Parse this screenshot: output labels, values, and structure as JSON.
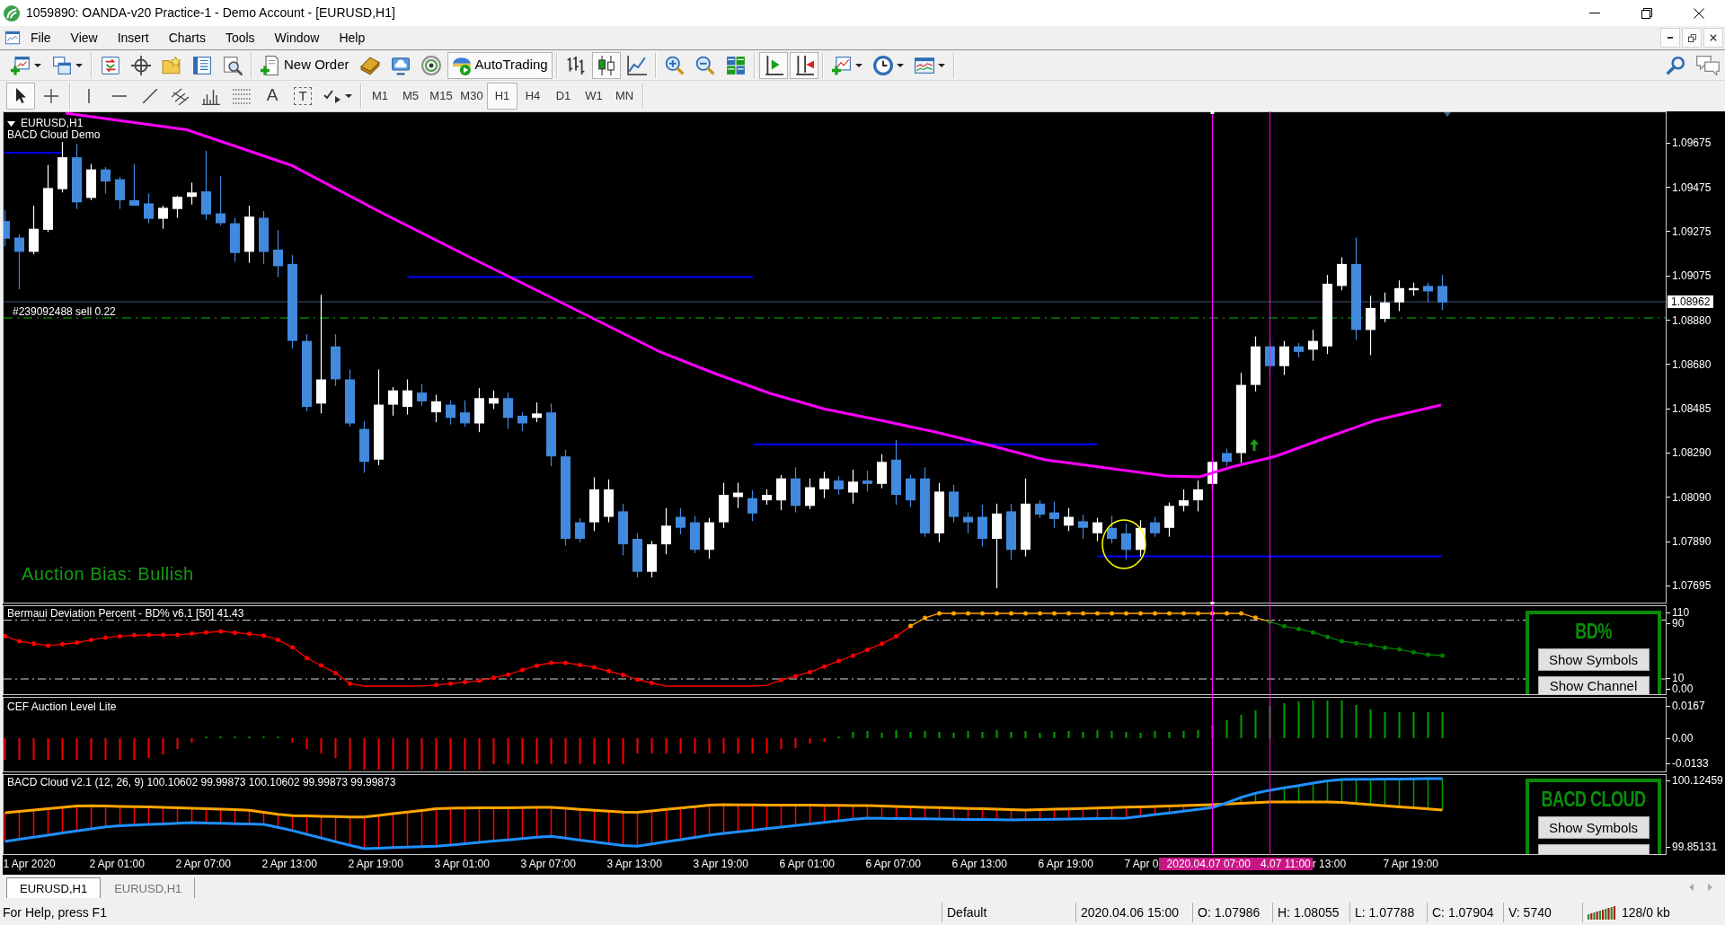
{
  "window": {
    "title": "1059890: OANDA-v20 Practice-1 - Demo Account - [EURUSD,H1]"
  },
  "menu": [
    "File",
    "View",
    "Insert",
    "Charts",
    "Tools",
    "Window",
    "Help"
  ],
  "toolbar": {
    "new_order": "New Order",
    "autotrading": {
      "label": "AutoTrading",
      "on": true
    },
    "chart_types": [
      {
        "kind": "bars",
        "selected": false
      },
      {
        "kind": "candles",
        "selected": true
      },
      {
        "kind": "line",
        "selected": false
      }
    ],
    "autoscroll": {
      "on": true
    },
    "chart_shift": {
      "on": true
    }
  },
  "drawing_tools": [
    {
      "kind": "cursor",
      "selected": true
    },
    {
      "kind": "crosshair",
      "selected": false
    },
    {
      "kind": "vertical_line",
      "selected": false
    },
    {
      "kind": "horizontal_line",
      "selected": false
    },
    {
      "kind": "trendline",
      "selected": false
    },
    {
      "kind": "channel",
      "selected": false
    },
    {
      "kind": "cycles",
      "selected": false
    },
    {
      "kind": "fibonacci",
      "selected": false
    },
    {
      "kind": "text",
      "label": "A",
      "selected": false
    },
    {
      "kind": "text_label",
      "label": "T",
      "selected": false
    },
    {
      "kind": "arrows",
      "selected": false
    }
  ],
  "timeframes": [
    {
      "label": "M1",
      "selected": false
    },
    {
      "label": "M5",
      "selected": false
    },
    {
      "label": "M15",
      "selected": false
    },
    {
      "label": "M30",
      "selected": false
    },
    {
      "label": "H1",
      "selected": true
    },
    {
      "label": "H4",
      "selected": false
    },
    {
      "label": "D1",
      "selected": false
    },
    {
      "label": "W1",
      "selected": false
    },
    {
      "label": "MN",
      "selected": false
    }
  ],
  "chart": {
    "symbol": "EURUSD,H1",
    "indicator": "BACD Cloud Demo",
    "order_label": "#239092488 sell 0.22",
    "bias": "Auction Bias: Bullish",
    "price_axis": [
      "1.09675",
      "1.09475",
      "1.09275",
      "1.09075",
      "1.08880",
      "1.08680",
      "1.08485",
      "1.08290",
      "1.08090",
      "1.07890",
      "1.07695"
    ],
    "current_price": "1.08962"
  },
  "indicator_panels": [
    {
      "kind": "bd",
      "title": "Bermaui Deviation Percent - BD% v6.1 [50] 41.43",
      "axis": [
        "110",
        "90",
        "10",
        "0.00"
      ],
      "widget": {
        "title": "BD%",
        "buttons": [
          {
            "kind": "button",
            "label": "Show Symbols"
          },
          {
            "kind": "button",
            "label": "Show Channel"
          }
        ]
      }
    },
    {
      "kind": "cef",
      "title": "CEF Auction Level Lite",
      "axis": [
        "0.0167",
        "0.00",
        "-0.0133"
      ]
    },
    {
      "kind": "bacd",
      "title": "BACD Cloud v2.1 (12, 26, 9) 100.10602 99.99873 100.10602 99.99873 99.99873",
      "axis": [
        "100.12459",
        "99.85131"
      ],
      "widget": {
        "title": "BACD CLOUD",
        "buttons": [
          {
            "kind": "button",
            "label": "Show Symbols"
          },
          {
            "kind": "stub"
          }
        ]
      }
    }
  ],
  "time_axis": [
    {
      "kind": "tick",
      "label": "1 Apr 2020"
    },
    {
      "kind": "tick",
      "label": "2 Apr 01:00"
    },
    {
      "kind": "tick",
      "label": "2 Apr 07:00"
    },
    {
      "kind": "tick",
      "label": "2 Apr 13:00"
    },
    {
      "kind": "tick",
      "label": "2 Apr 19:00"
    },
    {
      "kind": "tick",
      "label": "3 Apr 01:00"
    },
    {
      "kind": "tick",
      "label": "3 Apr 07:00"
    },
    {
      "kind": "tick",
      "label": "3 Apr 13:00"
    },
    {
      "kind": "tick",
      "label": "3 Apr 19:00"
    },
    {
      "kind": "tick",
      "label": "6 Apr 01:00"
    },
    {
      "kind": "tick",
      "label": "6 Apr 07:00"
    },
    {
      "kind": "tick",
      "label": "6 Apr 13:00"
    },
    {
      "kind": "tick",
      "label": "6 Apr 19:00"
    },
    {
      "kind": "tick",
      "label": "7 Apr 0"
    },
    {
      "kind": "cursor",
      "label": "2020.04.07 07:00"
    },
    {
      "kind": "cursor",
      "label": "4.07 11:00"
    },
    {
      "kind": "tick",
      "label": "r 13:00"
    },
    {
      "kind": "tick",
      "label": "7 Apr 19:00"
    }
  ],
  "chart_tabs": [
    {
      "label": "EURUSD,H1",
      "selected": true
    },
    {
      "label": "EURUSD,H1",
      "selected": false
    }
  ],
  "status_bar": {
    "help": "For Help, press F1",
    "profile": "Default",
    "time": "2020.04.06 15:00",
    "open": "O: 1.07986",
    "high": "H: 1.08055",
    "low": "L: 1.07788",
    "close": "C: 1.07904",
    "volume": "V: 5740",
    "traffic": "128/0 kb"
  }
}
